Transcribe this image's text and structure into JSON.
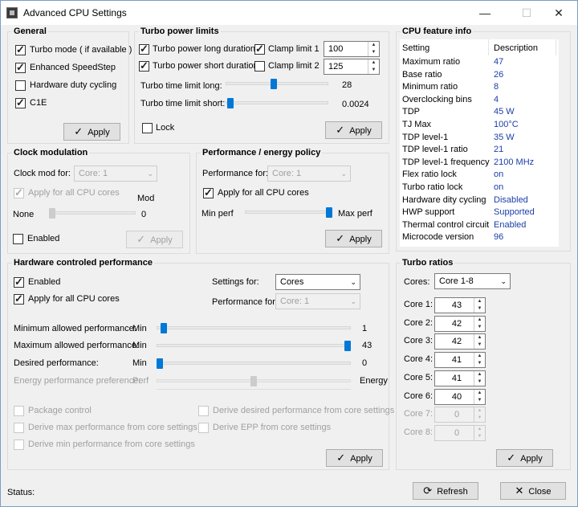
{
  "window": {
    "title": "Advanced CPU Settings",
    "minimize": "—",
    "maximize": "☐",
    "close": "✕"
  },
  "general": {
    "title": "General",
    "items": [
      {
        "label": "Turbo mode ( if available )",
        "checked": true
      },
      {
        "label": "Enhanced SpeedStep",
        "checked": true
      },
      {
        "label": "Hardware duty cycling",
        "checked": false
      },
      {
        "label": "C1E",
        "checked": true
      }
    ],
    "apply": "Apply"
  },
  "turbo": {
    "title": "Turbo power limits",
    "long": "Turbo power long duration",
    "short": "Turbo power short duration",
    "clamp1": "Clamp limit 1",
    "clamp2": "Clamp limit 2",
    "val1": "100",
    "val2": "125",
    "time_long": "Turbo time limit long:",
    "time_long_val": "28",
    "time_short": "Turbo time limit short:",
    "time_short_val": "0.0024",
    "lock": "Lock",
    "apply": "Apply"
  },
  "cpuinfo": {
    "title": "CPU feature info",
    "col_setting": "Setting",
    "col_desc": "Description",
    "rows": [
      [
        "Maximum ratio",
        "47"
      ],
      [
        "Base ratio",
        "26"
      ],
      [
        "Minimum ratio",
        "8"
      ],
      [
        "Overclocking bins",
        "4"
      ],
      [
        "TDP",
        "45 W"
      ],
      [
        "TJ Max",
        "100°C"
      ],
      [
        "TDP level-1",
        "35 W"
      ],
      [
        "TDP level-1 ratio",
        "21"
      ],
      [
        "TDP level-1 frequency",
        "2100 MHz"
      ],
      [
        "Flex ratio lock",
        "on"
      ],
      [
        "Turbo ratio lock",
        "on"
      ],
      [
        "Hardware dity cycling",
        "Disabled"
      ],
      [
        "HWP support",
        "Supported"
      ],
      [
        "Thermal control circuit",
        "Enabled"
      ],
      [
        "Microcode version",
        "96"
      ]
    ]
  },
  "clock": {
    "title": "Clock modulation",
    "for_label": "Clock mod  for:",
    "for_value": "Core: 1",
    "apply_all": "Apply for all CPU cores",
    "mod": "Mod",
    "none": "None",
    "value": "0",
    "enabled": "Enabled",
    "apply": "Apply"
  },
  "perf": {
    "title": "Performance / energy policy",
    "for_label": "Performance for:",
    "for_value": "Core: 1",
    "apply_all": "Apply for all CPU cores",
    "min": "Min perf",
    "max": "Max perf",
    "apply": "Apply"
  },
  "hwp": {
    "title": "Hardware controled performance",
    "enabled": "Enabled",
    "apply_all": "Apply for all CPU cores",
    "settings_for": "Settings for:",
    "settings_value": "Cores",
    "perf_for": "Performance for:",
    "perf_value": "Core: 1",
    "sliders": [
      {
        "label": "Minimum allowed performance:",
        "min": "Min",
        "value": "1",
        "level": 0.02
      },
      {
        "label": "Maximum allowed performance:",
        "min": "Min",
        "value": "43",
        "level": 1.0
      },
      {
        "label": "Desired performance:",
        "min": "Min",
        "value": "0",
        "level": 0.0
      }
    ],
    "epp_label": "Energy performance preference:",
    "epp_perf": "Perf",
    "epp_energy": "Energy",
    "opts": [
      "Package control",
      "Derive desired performance from core settings",
      "Derive max performance from core settings",
      "Derive EPP from core settings",
      "Derive min performance from core settings"
    ],
    "apply": "Apply"
  },
  "turbo_ratios": {
    "title": "Turbo ratios",
    "cores_label": "Cores:",
    "cores_value": "Core 1-8",
    "rows": [
      [
        "Core 1:",
        "43"
      ],
      [
        "Core 2:",
        "42"
      ],
      [
        "Core 3:",
        "42"
      ],
      [
        "Core 4:",
        "41"
      ],
      [
        "Core 5:",
        "41"
      ],
      [
        "Core 6:",
        "40"
      ],
      [
        "Core 7:",
        "0"
      ],
      [
        "Core 8:",
        "0"
      ]
    ],
    "apply": "Apply"
  },
  "footer": {
    "status": "Status:",
    "refresh": "Refresh",
    "close": "Close"
  }
}
